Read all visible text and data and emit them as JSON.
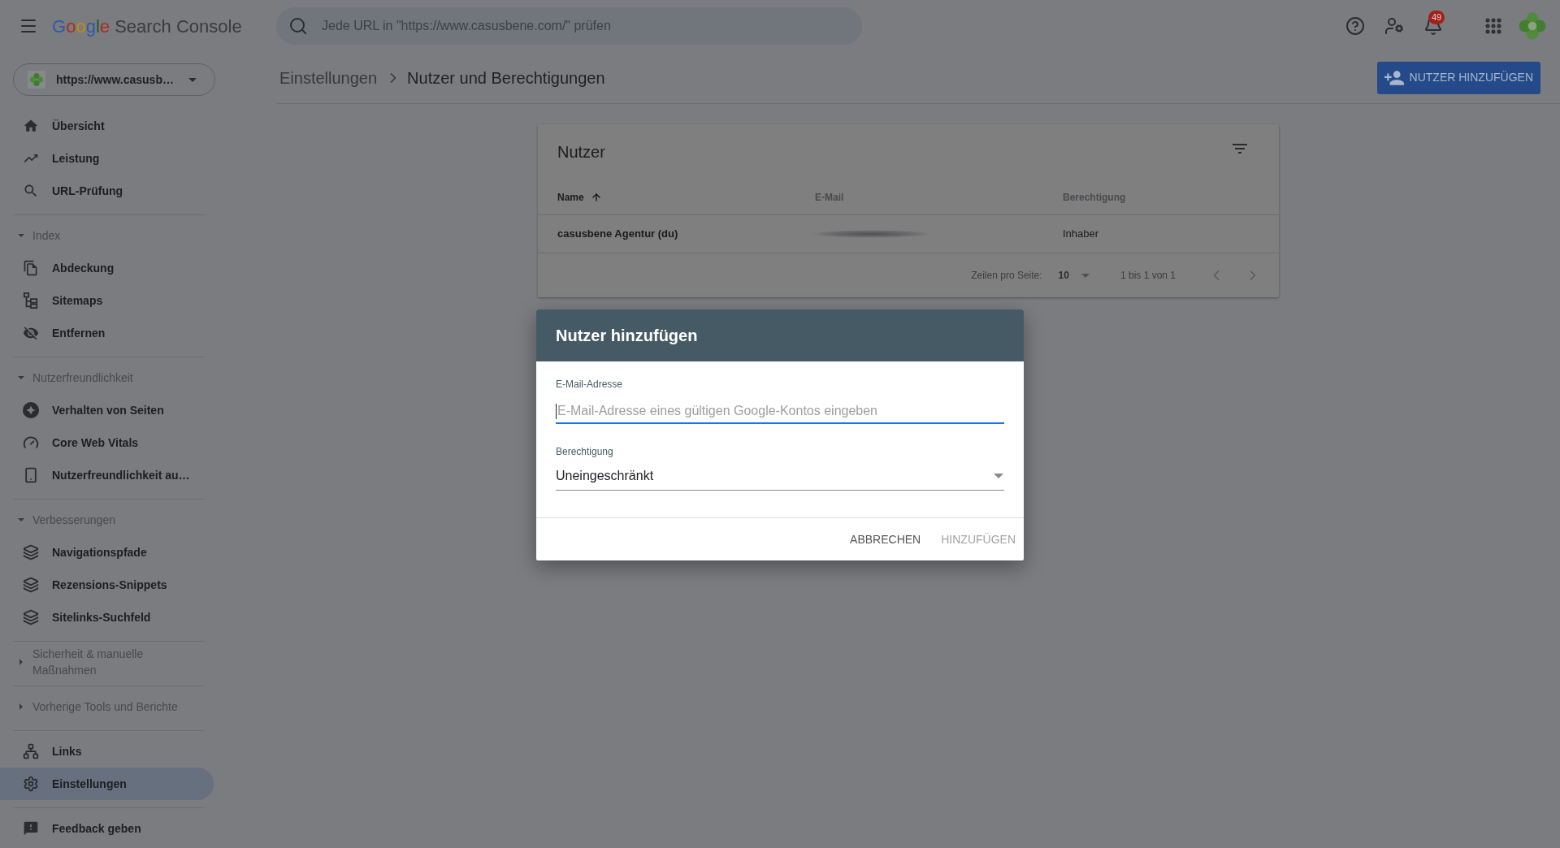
{
  "header": {
    "logo": {
      "brand": "Google",
      "product": "Search Console"
    },
    "search": {
      "placeholder": "Jede URL in \"https://www.casusbene.com/\" prüfen"
    },
    "notifications": {
      "badge": "49"
    }
  },
  "sidebar": {
    "property": {
      "value": "https://www.casusb…"
    },
    "sections": [
      {
        "children": [
          {
            "label": "Übersicht",
            "selected": false
          },
          {
            "label": "Leistung",
            "selected": false
          },
          {
            "label": "URL-Prüfung",
            "selected": false
          }
        ]
      },
      {
        "title": "Index",
        "expanded": true,
        "children": [
          {
            "label": "Abdeckung",
            "selected": false
          },
          {
            "label": "Sitemaps",
            "selected": false
          },
          {
            "label": "Entfernen",
            "selected": false
          }
        ]
      },
      {
        "title": "Nutzerfreundlichkeit",
        "expanded": true,
        "children": [
          {
            "label": "Verhalten von Seiten",
            "selected": false
          },
          {
            "label": "Core Web Vitals",
            "selected": false
          },
          {
            "label": "Nutzerfreundlichkeit au…",
            "selected": false
          }
        ]
      },
      {
        "title": "Verbesserungen",
        "expanded": true,
        "children": [
          {
            "label": "Navigationspfade",
            "selected": false
          },
          {
            "label": "Rezensions-Snippets",
            "selected": false
          },
          {
            "label": "Sitelinks-Suchfeld",
            "selected": false
          }
        ]
      },
      {
        "title": "Sicherheit & manuelle Maßnahmen",
        "expanded": false
      },
      {
        "title": "Vorherige Tools und Berichte",
        "expanded": false
      },
      {
        "children": [
          {
            "label": "Links",
            "selected": false
          },
          {
            "label": "Einstellungen",
            "selected": true
          }
        ]
      },
      {
        "children": [
          {
            "label": "Feedback geben",
            "selected": false
          }
        ]
      }
    ]
  },
  "page": {
    "breadcrumb": {
      "parent": "Einstellungen",
      "current": "Nutzer und Berechtigungen"
    },
    "add_button": {
      "label": "NUTZER HINZUFÜGEN"
    }
  },
  "users_table": {
    "title": "Nutzer",
    "columns": [
      {
        "label": "Name",
        "sorted": true
      },
      {
        "label": "E-Mail",
        "sorted": false
      },
      {
        "label": "Berechtigung",
        "sorted": false
      }
    ],
    "rows": [
      {
        "name": "casusbene Agentur (du)",
        "email_blurred": true,
        "permission": "Inhaber"
      }
    ],
    "pagination": {
      "rows_label": "Zeilen pro Seite:",
      "rows_per_page": "10",
      "range": "1 bis 1 von 1"
    }
  },
  "dialog": {
    "title": "Nutzer hinzufügen",
    "fields": [
      {
        "kind": "text",
        "label": "E-Mail-Adresse",
        "placeholder": "E-Mail-Adresse eines gültigen Google-Kontos eingeben",
        "focused": true
      },
      {
        "kind": "select",
        "label": "Berechtigung",
        "value": "Uneingeschränkt"
      }
    ],
    "buttons": [
      {
        "label": "ABBRECHEN",
        "disabled": false
      },
      {
        "label": "HINZUFÜGEN",
        "disabled": true
      }
    ]
  }
}
